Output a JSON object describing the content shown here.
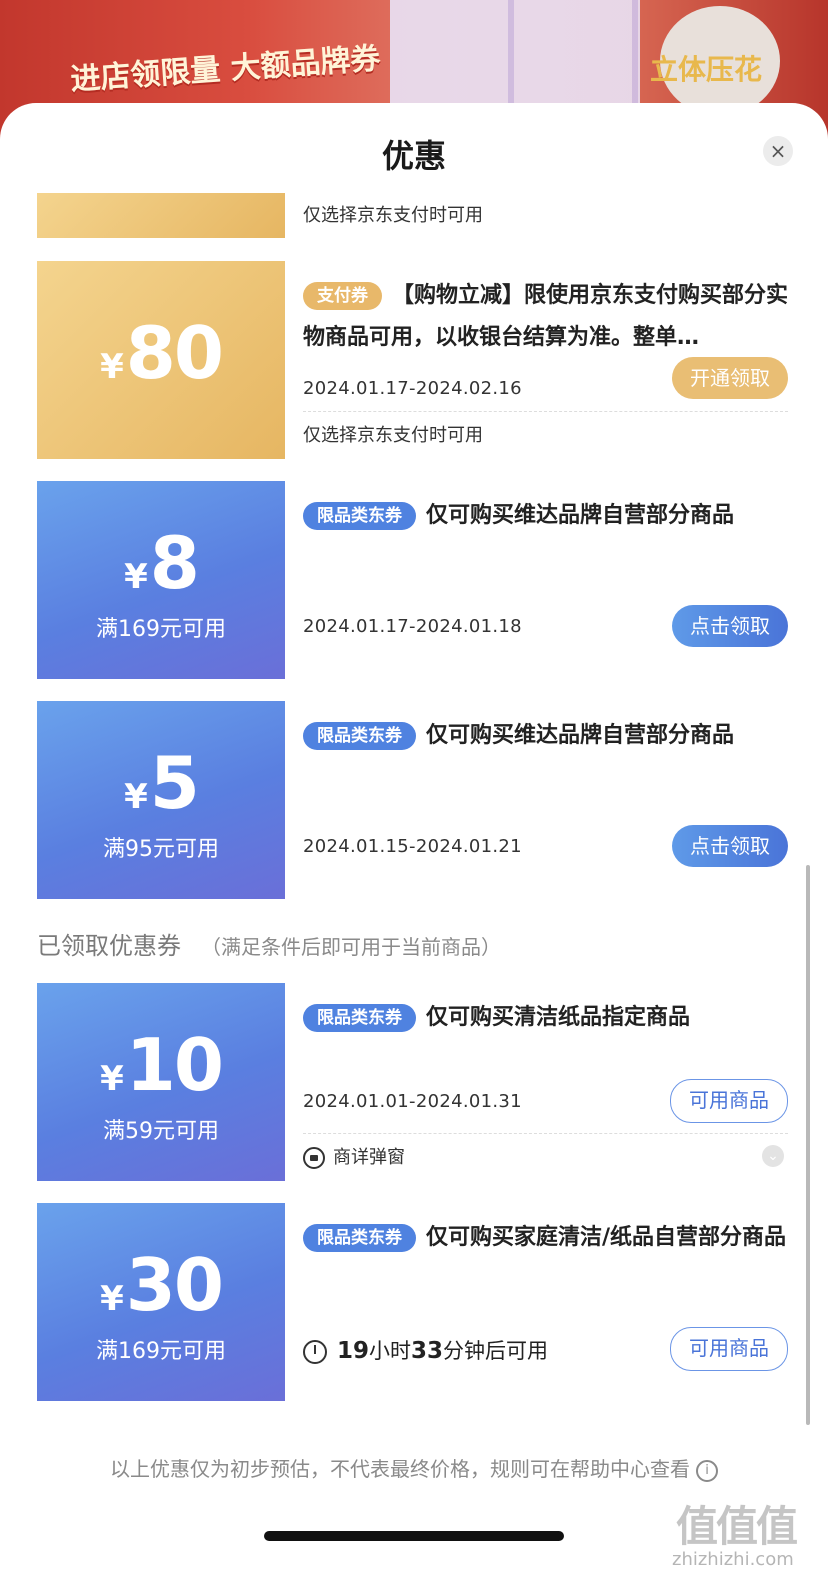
{
  "background": {
    "promo_text": "进店领限量 大额品牌券",
    "flower_text": "立体压花"
  },
  "header": {
    "title": "优惠",
    "close_icon": "×"
  },
  "partial_top": {
    "note": "仅选择京东支付时可用"
  },
  "coupons": [
    {
      "yen": "¥",
      "amount": "80",
      "tag": "支付券",
      "desc": "【购物立减】限使用京东支付购买部分实物商品可用，以收银台结算为准。整单…",
      "date": "2024.01.17-2024.02.16",
      "button": "开通领取",
      "note": "仅选择京东支付时可用"
    },
    {
      "yen": "¥",
      "amount": "8",
      "threshold": "满169元可用",
      "tag": "限品类东券",
      "desc": "仅可购买维达品牌自营部分商品",
      "date": "2024.01.17-2024.01.18",
      "button": "点击领取"
    },
    {
      "yen": "¥",
      "amount": "5",
      "threshold": "满95元可用",
      "tag": "限品类东券",
      "desc": "仅可购买维达品牌自营部分商品",
      "date": "2024.01.15-2024.01.21",
      "button": "点击领取"
    }
  ],
  "claimed_section": {
    "title": "已领取优惠券",
    "subtitle": "（满足条件后即可用于当前商品）"
  },
  "claimed": [
    {
      "yen": "¥",
      "amount": "10",
      "threshold": "满59元可用",
      "tag": "限品类东券",
      "desc": "仅可购买清洁纸品指定商品",
      "date": "2024.01.01-2024.01.31",
      "button": "可用商品",
      "note": "商详弹窗"
    },
    {
      "yen": "¥",
      "amount": "30",
      "threshold": "满169元可用",
      "tag": "限品类东券",
      "desc": "仅可购买家庭清洁/纸品自营部分商品",
      "countdown_hours": "19",
      "countdown_h_unit": "小时",
      "countdown_minutes": "33",
      "countdown_m_unit": "分钟后可用",
      "button": "可用商品"
    }
  ],
  "footer": {
    "note": "以上优惠仅为初步预估，不代表最终价格，规则可在帮助中心查看",
    "info_icon": "i"
  },
  "watermark": {
    "text": "值值值",
    "url": "zhizhizhi.com"
  }
}
